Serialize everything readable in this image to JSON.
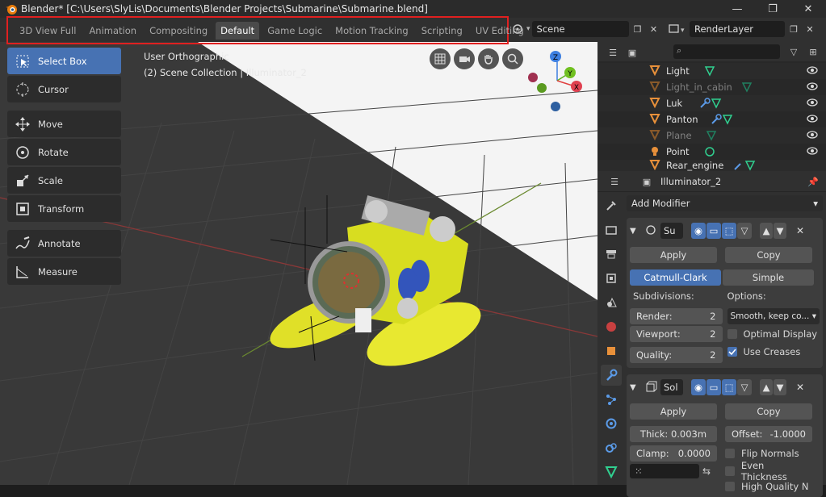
{
  "titlebar": {
    "title": "Blender* [C:\\Users\\SlyLis\\Documents\\Blender Projects\\Submarine\\Submarine.blend]",
    "minimize": "—",
    "maximize": "❐",
    "close": "✕"
  },
  "workspace_tabs": [
    {
      "label": "3D View Full",
      "active": false
    },
    {
      "label": "Animation",
      "active": false
    },
    {
      "label": "Compositing",
      "active": false
    },
    {
      "label": "Default",
      "active": true
    },
    {
      "label": "Game Logic",
      "active": false
    },
    {
      "label": "Motion Tracking",
      "active": false
    },
    {
      "label": "Scripting",
      "active": false
    },
    {
      "label": "UV Editing",
      "active": false
    }
  ],
  "scene": {
    "label": "Scene"
  },
  "view_layer": {
    "label": "RenderLayer"
  },
  "viewport": {
    "view_name": "User Orthographic",
    "collection_info": "(2) Scene Collection | Illuminator_2"
  },
  "tools": {
    "select_box": "Select Box",
    "cursor": "Cursor",
    "move": "Move",
    "rotate": "Rotate",
    "scale": "Scale",
    "transform": "Transform",
    "annotate": "Annotate",
    "measure": "Measure"
  },
  "gizmo": {
    "x": "X",
    "y": "Y",
    "z": "Z"
  },
  "outliner": {
    "rows": [
      {
        "label": "Light"
      },
      {
        "label": "Light_in_cabin"
      },
      {
        "label": "Luk"
      },
      {
        "label": "Panton"
      },
      {
        "label": "Plane"
      },
      {
        "label": "Point"
      },
      {
        "label": "Rear_engine"
      }
    ]
  },
  "properties": {
    "object_name": "Illuminator_2",
    "add_modifier": "Add Modifier",
    "mod1": {
      "name": "Su",
      "apply": "Apply",
      "copy": "Copy",
      "catmull": "Catmull-Clark",
      "simple": "Simple",
      "subdivisions_label": "Subdivisions:",
      "options_label": "Options:",
      "render_label": "Render:",
      "render_value": "2",
      "viewport_label": "Viewport:",
      "viewport_value": "2",
      "quality_label": "Quality:",
      "quality_value": "2",
      "uv_smooth": "Smooth, keep co...",
      "optimal_display": "Optimal Display",
      "use_creases": "Use Creases"
    },
    "mod2": {
      "name": "Sol",
      "apply": "Apply",
      "copy": "Copy",
      "thick": "Thick:  0.003m",
      "offset_label": "Offset:",
      "offset_value": "-1.0000",
      "clamp_label": "Clamp:",
      "clamp_value": "0.0000",
      "flip_normals": "Flip Normals",
      "even_thickness": "Even Thickness",
      "high_quality": "High Quality N"
    }
  }
}
